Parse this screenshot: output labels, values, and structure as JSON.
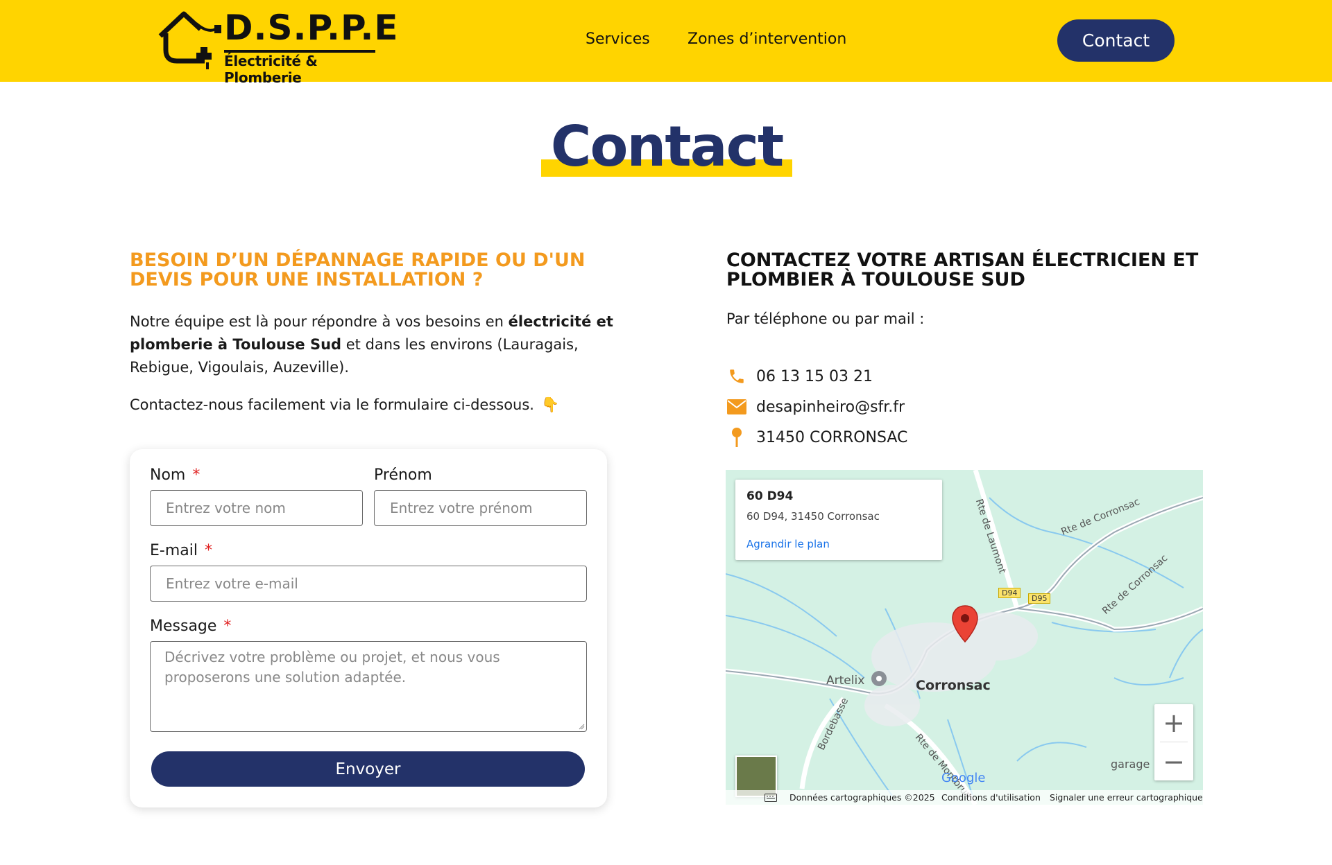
{
  "header": {
    "logo_title": "D.S.P.P.E",
    "logo_subtitle": "Électricité & Plomberie",
    "nav": [
      "Services",
      "Zones d’intervention"
    ],
    "contact_button": "Contact",
    "background_color": "#ffd400"
  },
  "page_title": "Contact",
  "left": {
    "heading": "BESOIN D’UN DÉPANNAGE RAPIDE OU D'UN DEVIS POUR UNE INSTALLATION ?",
    "para1_start": "Notre équipe est là pour répondre à vos besoins en ",
    "para1_bold": "électricité et plomberie à Toulouse Sud",
    "para1_end": " et dans les environs (Lauragais, Rebigue, Vigoulais, Auzeville).",
    "para2": "Contactez-nous facilement via le formulaire ci-dessous.",
    "para2_emoji": "👇"
  },
  "form": {
    "nom_label": "Nom",
    "nom_placeholder": "Entrez votre nom",
    "prenom_label": "Prénom",
    "prenom_placeholder": "Entrez votre prénom",
    "email_label": "E-mail",
    "email_placeholder": "Entrez votre e-mail",
    "message_label": "Message",
    "message_placeholder": "Décrivez votre problème ou projet, et nous vous proposerons une solution adaptée.",
    "required_mark": "*",
    "submit": "Envoyer"
  },
  "right": {
    "heading": "CONTACTEZ VOTRE ARTISAN ÉLECTRICIEN ET PLOMBIER À TOULOUSE SUD",
    "intro": "Par téléphone ou par mail :",
    "phone": "06 13 15 03 21",
    "email": "desapinheiro@sfr.fr",
    "address": "31450 CORRONSAC"
  },
  "map": {
    "card_title": "60 D94",
    "card_address": "60 D94, 31450 Corronsac",
    "card_link": "Agrandir le plan",
    "labels": {
      "corronsac": "Corronsac",
      "artelix": "Artelix",
      "rte_laumont": "Rte de Laumont",
      "rte_corronsac_1": "Rte de Corronsac",
      "rte_corronsac_2": "Rte de Corronsac",
      "bordebasse": "Bordebasse",
      "rte_montbrun": "Rte de Montbrun",
      "garage": "garage",
      "d94": "D94",
      "d95": "D95"
    },
    "google": "Google",
    "attribution_data": "Données cartographiques ©2025",
    "attribution_terms": "Conditions d'utilisation",
    "attribution_report": "Signaler une erreur cartographique",
    "zoom_in": "+",
    "zoom_out": "−"
  }
}
